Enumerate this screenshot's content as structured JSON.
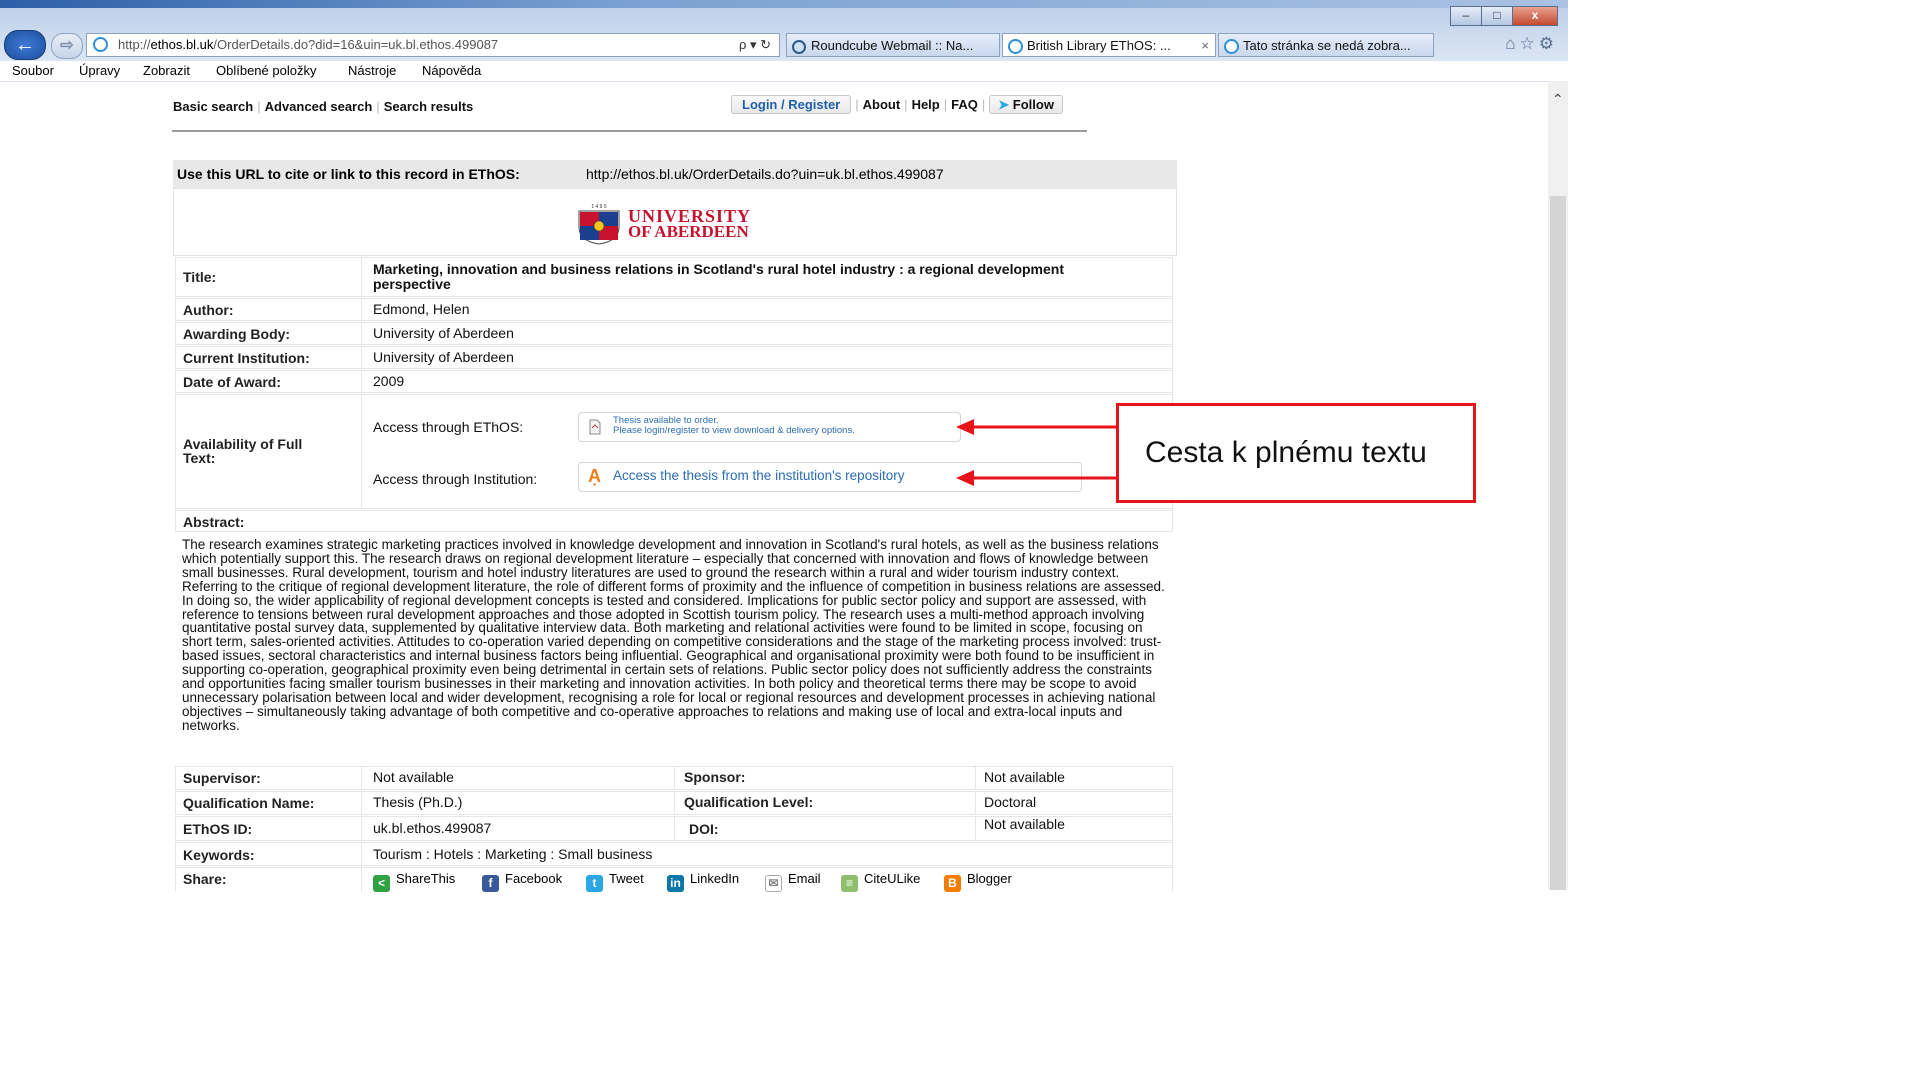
{
  "browser": {
    "url_prefix": "http://",
    "url_host": "ethos.bl.uk",
    "url_path": "/OrderDetails.do?did=16&uin=uk.bl.ethos.499087",
    "addr_tools": "ρ ▾ ↻",
    "tabs": [
      {
        "title": "Roundcube Webmail :: Na...",
        "icon": "roundcube-icon"
      },
      {
        "title": "British Library EThOS: ...",
        "icon": "ie-icon",
        "active": true
      },
      {
        "title": "Tato stránka se nedá zobra...",
        "icon": "ie-icon"
      }
    ],
    "tab_close": "×",
    "menu": [
      "Soubor",
      "Úpravy",
      "Zobrazit",
      "Oblíbené položky",
      "Nástroje",
      "Nápověda"
    ],
    "window_buttons": [
      "–",
      "□",
      "x"
    ],
    "right_icons": "⌂☆⚙"
  },
  "nav": {
    "left": [
      "Basic search",
      "Advanced search",
      "Search results"
    ],
    "login": "Login / Register",
    "right": [
      "About",
      "Help",
      "FAQ"
    ],
    "follow": "Follow"
  },
  "cite": {
    "label": "Use this URL to cite or link to this record in EThOS:",
    "url": "http://ethos.bl.uk/OrderDetails.do?uin=uk.bl.ethos.499087"
  },
  "logo": {
    "line1": "UNIVERSITY",
    "line2": "OF ABERDEEN",
    "crest_text": "1 4 9 5"
  },
  "record": {
    "title_label": "Title:",
    "title": "Marketing, innovation and business relations in Scotland's rural hotel industry : a regional development perspective",
    "author_label": "Author:",
    "author": "Edmond, Helen",
    "awarding_label": "Awarding Body:",
    "awarding": "University of Aberdeen",
    "institution_label": "Current Institution:",
    "institution": "University of Aberdeen",
    "date_label": "Date of Award:",
    "date": "2009",
    "availability_label": "Availability of Full Text:",
    "access_ethos_label": "Access through EThOS:",
    "access_ethos_line1": "Thesis available to order.",
    "access_ethos_line2": "Please login/register to view download & delivery options.",
    "access_inst_label": "Access through Institution:",
    "access_inst_link": "Access the thesis from the institution's repository",
    "abstract_label": "Abstract:",
    "abstract": "The research examines strategic marketing practices involved in knowledge development and innovation in Scotland's rural hotels, as well as the business relations which potentially support this.  The research draws on regional development  literature – especially that concerned with innovation and flows of knowledge between small businesses.  Rural development, tourism and hotel industry literatures are used to ground the research within a rural and wider tourism industry context.  Referring to the critique of regional development literature, the role of different forms of proximity and the influence of competition in business relations are assessed.  In doing so, the wider applicability of regional development concepts is tested and considered.  Implications for public sector policy and support are assessed, with reference to tensions between rural development approaches and those adopted in Scottish tourism policy.  The research uses a multi-method approach involving quantitative postal survey data, supplemented by qualitative interview data.  Both marketing and relational activities were found to be limited in scope, focusing on short term, sales-oriented activities.  Attitudes to co-operation varied depending on competitive considerations and the stage of the marketing process involved: trust-based issues, sectoral characteristics and internal business factors being influential. Geographical and organisational proximity were both found to be insufficient in supporting co-operation, geographical proximity even being detrimental in certain sets of relations.  Public sector policy does not sufficiently address the constraints and opportunities facing smaller tourism businesses in their marketing and innovation activities.  In both policy and theoretical terms there may be scope to avoid unnecessary polarisation between local and wider development, recognising a role for local or regional resources and development processes in achieving national objectives – simultaneously taking advantage of both competitive and co-operative approaches to relations and making use of local and extra-local inputs and networks.",
    "supervisor_label": "Supervisor:",
    "supervisor": "Not available",
    "sponsor_label": "Sponsor:",
    "sponsor": "Not available",
    "qual_name_label": "Qualification Name:",
    "qual_name": "Thesis (Ph.D.)",
    "qual_level_label": "Qualification Level:",
    "qual_level": "Doctoral",
    "ethos_id_label": "EThOS ID:",
    "ethos_id": "uk.bl.ethos.499087",
    "doi_label": "DOI:",
    "doi": "Not available",
    "keywords_label": "Keywords:",
    "keywords": "Tourism : Hotels : Marketing : Small business",
    "share_label": "Share:",
    "share": [
      "ShareThis",
      "Facebook",
      "Tweet",
      "LinkedIn",
      "Email",
      "CiteULike",
      "Blogger"
    ]
  },
  "annotation": {
    "callout": "Cesta k plnému textu",
    "color": "#e8121b"
  }
}
